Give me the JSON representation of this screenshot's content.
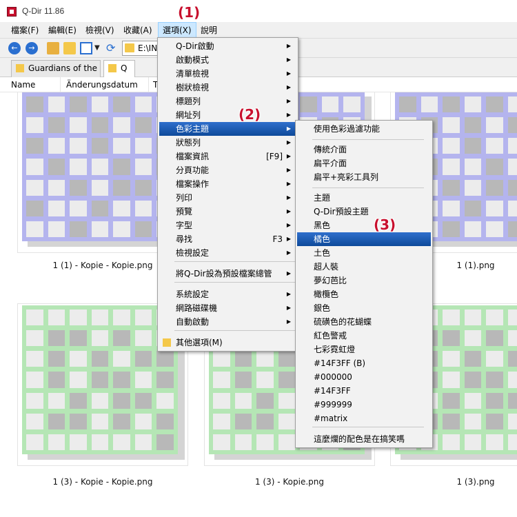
{
  "window": {
    "title": "Q-Dir 11.86"
  },
  "menubar": [
    {
      "label": "檔案(F)"
    },
    {
      "label": "編輯(E)"
    },
    {
      "label": "檢視(V)"
    },
    {
      "label": "收藏(A)"
    },
    {
      "label": "選項(X)"
    },
    {
      "label": "說明"
    }
  ],
  "toolbar": {
    "address_value": "E:\\INI"
  },
  "tabs": [
    {
      "label": "Guardians of the ..."
    },
    {
      "label": "Q"
    }
  ],
  "columns": [
    {
      "label": "Name"
    },
    {
      "label": "Änderungsdatum"
    },
    {
      "label": "T"
    }
  ],
  "files": [
    {
      "name": "1 (1) - Kopie - Kopie.png",
      "color": "purple"
    },
    {
      "name": "",
      "color": "purple"
    },
    {
      "name": "1 (1).png",
      "color": "purple"
    },
    {
      "name": "1 (3) - Kopie - Kopie.png",
      "color": "green"
    },
    {
      "name": "1 (3) - Kopie.png",
      "color": "green"
    },
    {
      "name": "1 (3).png",
      "color": "green"
    }
  ],
  "options_menu": {
    "items": [
      {
        "label": "Q-Dir啟動",
        "submenu": true
      },
      {
        "label": "啟動模式",
        "submenu": true
      },
      {
        "label": "清單檢視",
        "submenu": true
      },
      {
        "label": "樹狀檢視",
        "submenu": true
      },
      {
        "label": "標題列",
        "submenu": true
      },
      {
        "label": "網址列",
        "submenu": true
      },
      {
        "label": "色彩主題",
        "submenu": true
      },
      {
        "label": "狀態列",
        "submenu": true
      },
      {
        "label": "檔案資訊",
        "shortcut": "[F9]",
        "submenu": true
      },
      {
        "label": "分頁功能",
        "submenu": true
      },
      {
        "label": "檔案操作",
        "submenu": true
      },
      {
        "label": "列印",
        "submenu": true
      },
      {
        "label": "預覽",
        "submenu": true
      },
      {
        "label": "字型",
        "submenu": true
      },
      {
        "label": "尋找",
        "shortcut": "F3",
        "submenu": true
      },
      {
        "label": "檢視設定",
        "submenu": true
      },
      {
        "label": "將Q-Dir設為預設檔案總管",
        "submenu": true
      },
      {
        "label": "系統設定",
        "submenu": true
      },
      {
        "label": "網路磁碟機",
        "submenu": true
      },
      {
        "label": "自動啟動",
        "submenu": true
      },
      {
        "label": "其他選項(M)",
        "submenu": false
      }
    ]
  },
  "color_menu": {
    "items": [
      {
        "label": "使用色彩過濾功能"
      },
      {
        "label": "傳統介面"
      },
      {
        "label": "扁平介面"
      },
      {
        "label": "扁平+亮彩工具列"
      },
      {
        "label": "主題"
      },
      {
        "label": "Q-Dir預設主題"
      },
      {
        "label": "黑色"
      },
      {
        "label": "橘色"
      },
      {
        "label": "土色"
      },
      {
        "label": "超人裝"
      },
      {
        "label": "夢幻芭比"
      },
      {
        "label": "橄欖色"
      },
      {
        "label": "銀色"
      },
      {
        "label": "硫磺色的花蝴蝶"
      },
      {
        "label": "紅色警戒"
      },
      {
        "label": "七彩霓虹燈"
      },
      {
        "label": "#14F3FF (B)"
      },
      {
        "label": "#000000"
      },
      {
        "label": "#14F3FF"
      },
      {
        "label": "#999999"
      },
      {
        "label": "#matrix"
      },
      {
        "label": "這麼爛的配色是在搞笑嗎"
      }
    ]
  },
  "annotations": [
    "(1)",
    "(2)",
    "(3)"
  ],
  "colors": {
    "highlight": "#1e5bb0",
    "annotation": "#c8102e",
    "thumb_purple": "#b4b4ee",
    "thumb_green": "#b5e6b5"
  }
}
